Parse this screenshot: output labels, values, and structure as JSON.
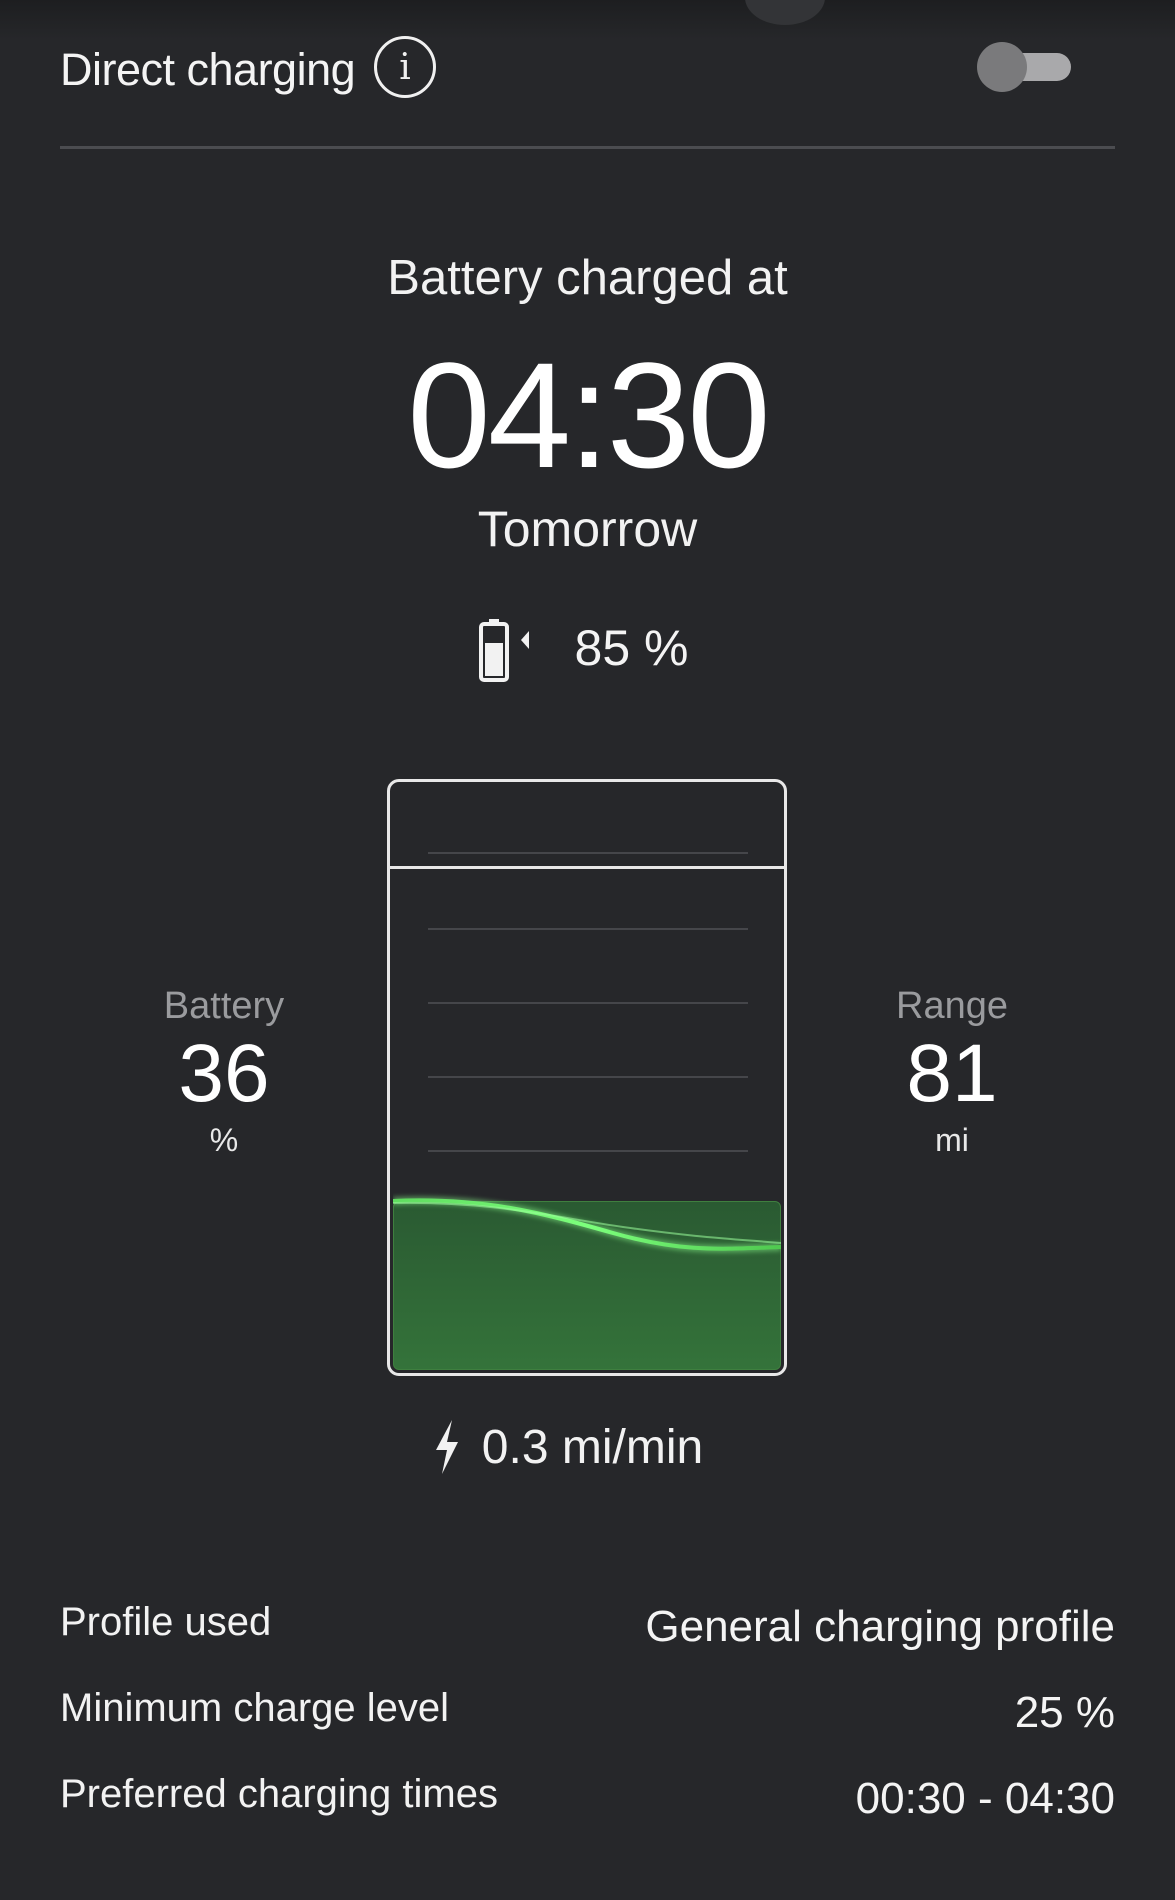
{
  "header": {
    "title": "Direct charging",
    "info_icon": "info-icon",
    "toggle_state": "off"
  },
  "charging": {
    "label": "Battery charged at",
    "time": "04:30",
    "day": "Tomorrow",
    "target_icon": "battery-charging-icon",
    "target_level": "85 %"
  },
  "battery": {
    "label": "Battery",
    "value": "36",
    "unit": "%",
    "fill_fraction": 0.36
  },
  "range": {
    "label": "Range",
    "value": "81",
    "unit": "mi"
  },
  "rate": {
    "icon": "lightning-bolt-icon",
    "value": "0.3 mi/min"
  },
  "details": [
    {
      "label": "Profile used",
      "value": "General charging profile"
    },
    {
      "label": "Minimum charge level",
      "value": "25 %"
    },
    {
      "label": "Preferred charging times",
      "value": "00:30 - 04:30"
    }
  ],
  "colors": {
    "background": "#26272a",
    "fill_green": "#34733a",
    "wave_green": "#6ef06e"
  }
}
